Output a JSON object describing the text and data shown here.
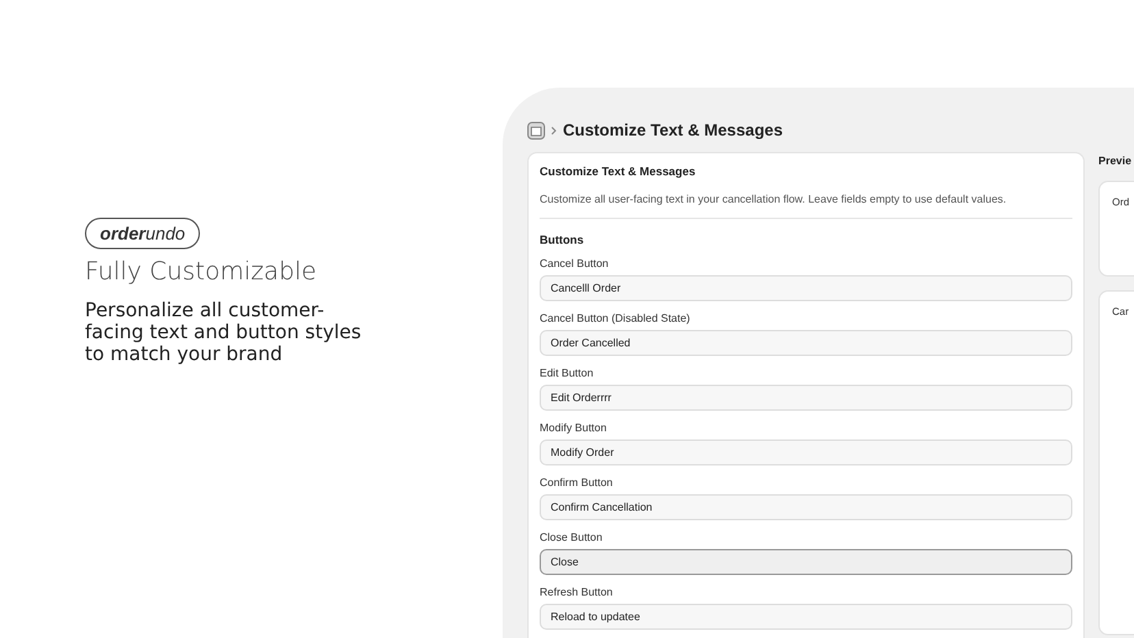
{
  "brand": {
    "bold": "order",
    "light": "undo"
  },
  "hero": {
    "title": "Fully Customizable",
    "subtitle": "Personalize all customer-facing text and button styles to match your brand"
  },
  "breadcrumb": {
    "title": "Customize Text & Messages"
  },
  "card": {
    "title": "Customize Text & Messages",
    "description": "Customize all user-facing text in your cancellation flow. Leave fields empty to use default values.",
    "section": "Buttons",
    "fields": [
      {
        "label": "Cancel Button",
        "value": "Cancelll Order",
        "focused": false
      },
      {
        "label": "Cancel Button (Disabled State)",
        "value": "Order Cancelled",
        "focused": false
      },
      {
        "label": "Edit Button",
        "value": "Edit Orderrrr",
        "focused": false
      },
      {
        "label": "Modify Button",
        "value": "Modify Order",
        "focused": false
      },
      {
        "label": "Confirm Button",
        "value": "Confirm Cancellation",
        "focused": false
      },
      {
        "label": "Close Button",
        "value": "Close",
        "focused": true
      },
      {
        "label": "Refresh Button",
        "value": "Reload to updatee",
        "focused": false
      }
    ]
  },
  "preview": {
    "heading": "Previe",
    "cards": [
      {
        "title": "Ord"
      },
      {
        "title": "Car"
      }
    ]
  }
}
